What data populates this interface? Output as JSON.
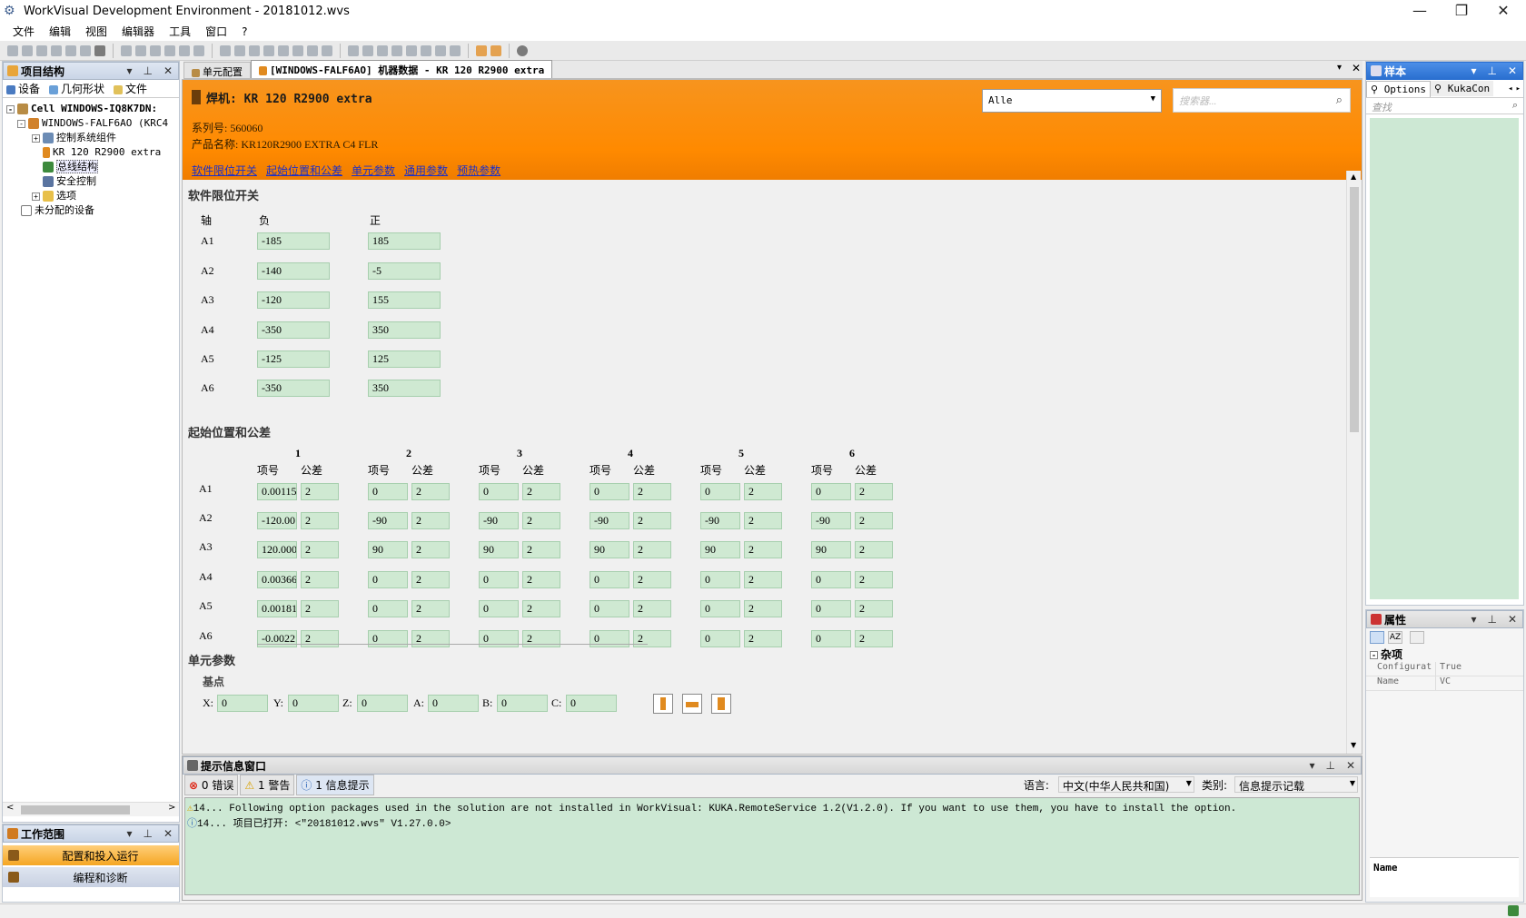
{
  "title": "WorkVisual Development Environment - 20181012.wvs",
  "menu": [
    "文件",
    "编辑",
    "视图",
    "编辑器",
    "工具",
    "窗口",
    "?"
  ],
  "left_panel": {
    "title": "项目结构",
    "tabs": [
      "设备",
      "几何形状",
      "文件"
    ],
    "tree": [
      {
        "label": "Cell WINDOWS-IQ8K7DN:",
        "level": 0,
        "exp": "-"
      },
      {
        "label": "WINDOWS-FALF6AO (KRC4",
        "level": 1,
        "exp": "-"
      },
      {
        "label": "控制系统组件",
        "level": 2,
        "exp": "+"
      },
      {
        "label": "KR 120 R2900 extra",
        "level": 2,
        "exp": ""
      },
      {
        "label": "总线结构",
        "level": 2,
        "exp": ""
      },
      {
        "label": "安全控制",
        "level": 2,
        "exp": ""
      },
      {
        "label": "选项",
        "level": 2,
        "exp": "+"
      },
      {
        "label": "未分配的设备",
        "level": 1,
        "exp": ""
      }
    ]
  },
  "workspace": {
    "title": "工作范围",
    "items": [
      "配置和投入运行",
      "编程和诊断"
    ]
  },
  "doc_tabs": [
    "单元配置",
    "[WINDOWS-FALF6AO] 机器数据 - KR 120 R2900 extra"
  ],
  "header": {
    "robot": "焊机: KR 120 R2900 extra",
    "serial": "系列号: 560060",
    "product": "产品名称: KR120R2900 EXTRA C4 FLR",
    "filter_select": "Alle",
    "search_placeholder": "搜索器...",
    "links": [
      "软件限位开关",
      "起始位置和公差",
      "单元参数",
      "通用参数",
      "预热参数"
    ]
  },
  "soft_limits": {
    "title": "软件限位开关",
    "col_axis": "轴",
    "col_neg": "负",
    "col_pos": "正",
    "rows": [
      {
        "axis": "A1",
        "neg": "-185",
        "pos": "185"
      },
      {
        "axis": "A2",
        "neg": "-140",
        "pos": "-5"
      },
      {
        "axis": "A3",
        "neg": "-120",
        "pos": "155"
      },
      {
        "axis": "A4",
        "neg": "-350",
        "pos": "350"
      },
      {
        "axis": "A5",
        "neg": "-125",
        "pos": "125"
      },
      {
        "axis": "A6",
        "neg": "-350",
        "pos": "350"
      }
    ]
  },
  "home": {
    "title": "起始位置和公差",
    "groups": [
      "1",
      "2",
      "3",
      "4",
      "5",
      "6"
    ],
    "sub_item": "项号",
    "sub_tol": "公差",
    "axes": [
      "A1",
      "A2",
      "A3",
      "A4",
      "A5",
      "A6"
    ],
    "values": [
      [
        "0.00115",
        "-120.00",
        "120.000",
        "0.00366",
        "0.00181",
        "-0.0022"
      ],
      [
        "0",
        "-90",
        "90",
        "0",
        "0",
        "0"
      ],
      [
        "0",
        "-90",
        "90",
        "0",
        "0",
        "0"
      ],
      [
        "0",
        "-90",
        "90",
        "0",
        "0",
        "0"
      ],
      [
        "0",
        "-90",
        "90",
        "0",
        "0",
        "0"
      ],
      [
        "0",
        "-90",
        "90",
        "0",
        "0",
        "0"
      ]
    ],
    "tolerance": "2"
  },
  "cell": {
    "title": "单元参数",
    "base_label": "基点",
    "coords": [
      {
        "label": "X:",
        "value": "0"
      },
      {
        "label": "Y:",
        "value": "0"
      },
      {
        "label": "Z:",
        "value": "0"
      },
      {
        "label": "A:",
        "value": "0"
      },
      {
        "label": "B:",
        "value": "0"
      },
      {
        "label": "C:",
        "value": "0"
      }
    ]
  },
  "messages": {
    "title": "提示信息窗口",
    "errors": "0 错误",
    "warnings": "1 警告",
    "infos": "1 信息提示",
    "lang_label": "语言:",
    "lang_value": "中文(中华人民共和国)",
    "cat_label": "类别:",
    "cat_value": "信息提示记载",
    "lines": [
      "14...   Following option packages used in the solution are not installed in WorkVisual: KUKA.RemoteService 1.2(V1.2.0). If you want to use them, you have to install the option.",
      "14...   项目已打开: <\"20181012.wvs\"  V1.27.0.0>"
    ]
  },
  "right_top": {
    "title": "样本",
    "tabs": [
      "Options",
      "KukaCon"
    ],
    "search_placeholder": "查找"
  },
  "properties": {
    "title": "属性",
    "category": "杂项",
    "rows": [
      {
        "name": "Configurat",
        "value": "True"
      },
      {
        "name": "Name",
        "value": "VC"
      }
    ],
    "desc": "Name"
  }
}
